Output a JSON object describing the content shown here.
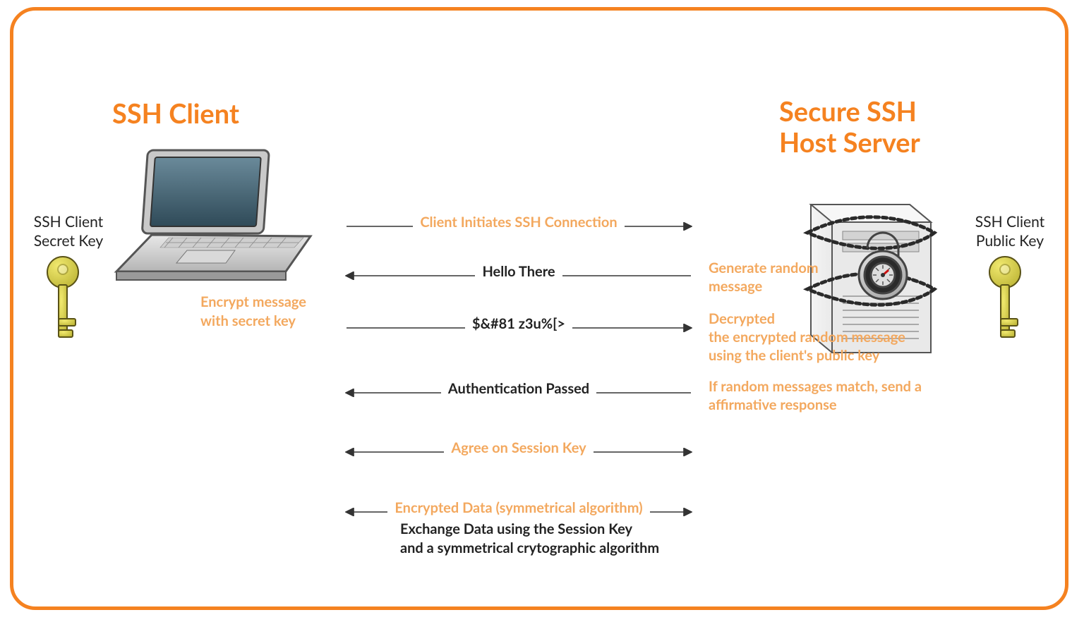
{
  "titles": {
    "client": "SSH Client",
    "server_l1": "Secure SSH",
    "server_l2": "Host Server"
  },
  "keys": {
    "left_l1": "SSH Client",
    "left_l2": "Secret Key",
    "right_l1": "SSH Client",
    "right_l2": "Public Key"
  },
  "client_note_l1": "Encrypt message",
  "client_note_l2": "with secret key",
  "server_notes": {
    "n1_l1": "Generate random",
    "n1_l2": "message",
    "n2_l1": "Decrypted",
    "n2_l2": "the encrypted random message",
    "n2_l3": "using the client's public key",
    "n3_l1": "If random messages match, send a",
    "n3_l2": "affirmative response"
  },
  "rows": {
    "r1": "Client Initiates SSH Connection",
    "r2": "Hello There",
    "r3": "$&#81 z3u%[>",
    "r4": "Authentication Passed",
    "r5": "Agree on Session Key",
    "r6": "Encrypted Data (symmetrical algorithm)"
  },
  "subtext_l1": "Exchange Data using the Session Key",
  "subtext_l2": "and a symmetrical crytographic algorithm"
}
